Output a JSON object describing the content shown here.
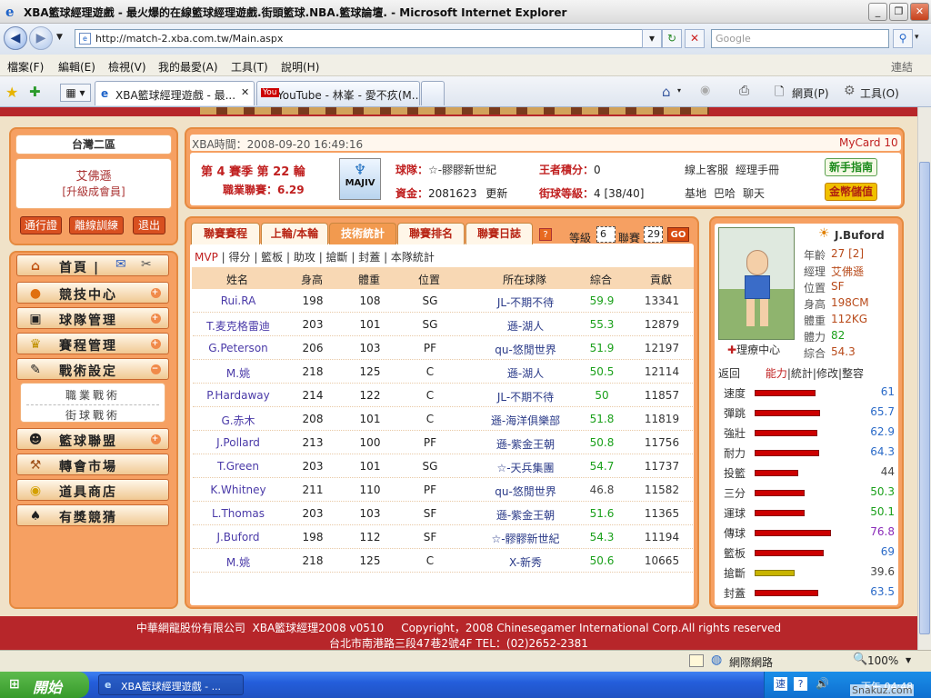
{
  "window": {
    "title": "XBA籃球經理遊戲 - 最火爆的在線籃球經理遊戲.街頭籃球.NBA.籃球論壇. - Microsoft Internet Explorer"
  },
  "address": {
    "url": "http://match-2.xba.com.tw/Main.aspx",
    "search_placeholder": "Google"
  },
  "menu": [
    "檔案(F)",
    "編輯(E)",
    "檢視(V)",
    "我的最愛(A)",
    "工具(T)",
    "說明(H)"
  ],
  "menu_right": "連結",
  "tabs": [
    {
      "label": "XBA籃球經理遊戲 - 最..."
    },
    {
      "label": "YouTube - 林峯 - 愛不疚(M..."
    }
  ],
  "toolbar": {
    "page_label": "網頁(P)",
    "tools_label": "工具(O)"
  },
  "sidebar": {
    "region": "台灣二區",
    "user_name": "艾佛遜",
    "user_level": "[升級成會員]",
    "buttons": [
      "通行證",
      "離線訓練",
      "退出"
    ],
    "nav": [
      {
        "label": "首頁",
        "icon": "home-icon"
      },
      {
        "label": "競技中心",
        "icon": "basketball-icon"
      },
      {
        "label": "球隊管理",
        "icon": "clipboard-icon"
      },
      {
        "label": "賽程管理",
        "icon": "trophy-icon"
      },
      {
        "label": "戰術設定",
        "icon": "tactics-icon"
      }
    ],
    "tactics_sub": [
      "職業戰術",
      "街球戰術"
    ],
    "nav2": [
      {
        "label": "籃球聯盟",
        "icon": "team-icon"
      },
      {
        "label": "轉會市場",
        "icon": "hammer-icon"
      },
      {
        "label": "道具商店",
        "icon": "coins-icon"
      },
      {
        "label": "有獎競猜",
        "icon": "spade-icon"
      }
    ]
  },
  "info": {
    "time_label": "XBA時間：2008-09-20 16:49:16",
    "mycard": "MyCard 10",
    "season_line": "第 4 賽季 第 22 輪",
    "league_label": "職業聯賽：6.29",
    "logo_text": "MAJIV",
    "team_label": "球隊：",
    "team_name": "☆-髎髎新世紀",
    "points_label": "王者積分：",
    "points_value": "0",
    "service": "線上客服",
    "manual": "經理手冊",
    "newbie_btn": "新手指南",
    "funds_label": "資金：",
    "funds_value": "2081623",
    "refresh": "更新",
    "level_label": "街球等級：",
    "level_value": "4 [38/40]",
    "base": "基地",
    "bar": "巴哈",
    "chat": "聊天",
    "gold_btn": "金幣儲值"
  },
  "main": {
    "tabs": [
      "聯賽賽程",
      "上輪/本輪",
      "技術統計",
      "聯賽排名",
      "聯賽日誌"
    ],
    "active_tab": 2,
    "level_label": "等級",
    "level_value": "6",
    "league_label": "聯賽",
    "league_value": "29",
    "go": "GO",
    "subnav": [
      "MVP",
      "得分",
      "籃板",
      "助攻",
      "搶斷",
      "封蓋",
      "本隊統計"
    ],
    "columns": [
      "姓名",
      "身高",
      "體重",
      "位置",
      "所在球隊",
      "綜合",
      "貢獻"
    ],
    "rows": [
      [
        "Rui.RA",
        "198",
        "108",
        "SG",
        "JL-不期不待",
        "59.9",
        "13341"
      ],
      [
        "T.麦克格雷迪",
        "203",
        "101",
        "SG",
        "遜-湖人",
        "55.3",
        "12879"
      ],
      [
        "G.Peterson",
        "206",
        "103",
        "PF",
        "qu-悠閒世界",
        "51.9",
        "12197"
      ],
      [
        "M.姚",
        "218",
        "125",
        "C",
        "遜-湖人",
        "50.5",
        "12114"
      ],
      [
        "P.Hardaway",
        "214",
        "122",
        "C",
        "JL-不期不待",
        "50",
        "11857"
      ],
      [
        "G.赤木",
        "208",
        "101",
        "C",
        "遜-海洋俱樂部",
        "51.8",
        "11819"
      ],
      [
        "J.Pollard",
        "213",
        "100",
        "PF",
        "遜-紫金王朝",
        "50.8",
        "11756"
      ],
      [
        "T.Green",
        "203",
        "101",
        "SG",
        "☆-天兵集團",
        "54.7",
        "11737"
      ],
      [
        "K.Whitney",
        "211",
        "110",
        "PF",
        "qu-悠閒世界",
        "46.8",
        "11582"
      ],
      [
        "L.Thomas",
        "203",
        "103",
        "SF",
        "遜-紫金王朝",
        "51.6",
        "11365"
      ],
      [
        "J.Buford",
        "198",
        "112",
        "SF",
        "☆-髎髎新世紀",
        "54.3",
        "11194"
      ],
      [
        "M.姚",
        "218",
        "125",
        "C",
        "X-新秀",
        "50.6",
        "10665"
      ]
    ]
  },
  "player": {
    "name": "J.Buford",
    "fields": [
      [
        "年齡",
        "27 [2]"
      ],
      [
        "經理",
        "艾佛遜"
      ],
      [
        "位置",
        "SF"
      ],
      [
        "身高",
        "198CM"
      ],
      [
        "體重",
        "112KG"
      ],
      [
        "體力",
        "82"
      ],
      [
        "綜合",
        "54.3"
      ]
    ],
    "treatment": "理療中心",
    "links": [
      "返回",
      "能力",
      "統計",
      "修改",
      "整容"
    ],
    "stats": [
      {
        "name": "速度",
        "value": "61",
        "level": 0.61
      },
      {
        "name": "彈跳",
        "value": "65.7",
        "level": 0.657
      },
      {
        "name": "強壯",
        "value": "62.9",
        "level": 0.629
      },
      {
        "name": "耐力",
        "value": "64.3",
        "level": 0.643
      },
      {
        "name": "投籃",
        "value": "44",
        "level": 0.44
      },
      {
        "name": "三分",
        "value": "50.3",
        "level": 0.503
      },
      {
        "name": "運球",
        "value": "50.1",
        "level": 0.501
      },
      {
        "name": "傳球",
        "value": "76.8",
        "level": 0.768
      },
      {
        "name": "籃板",
        "value": "69",
        "level": 0.69
      },
      {
        "name": "搶斷",
        "value": "39.6",
        "level": 0.396
      },
      {
        "name": "封蓋",
        "value": "63.5",
        "level": 0.635
      }
    ]
  },
  "footer": {
    "line1": "中華網龍股份有限公司  XBA籃球經理2008 v0510     Copyright，2008 Chinesegamer International Corp.All rights reserved",
    "line2": "台北市南港路三段47巷2號4F TEL：(02)2652-2381"
  },
  "status": {
    "zone": "網際網路",
    "zoom": "100%"
  },
  "taskbar": {
    "start": "開始",
    "item": "XBA籃球經理遊戲 - ...",
    "clock": "下午 04:48",
    "watermark": "Snakuz.com"
  }
}
